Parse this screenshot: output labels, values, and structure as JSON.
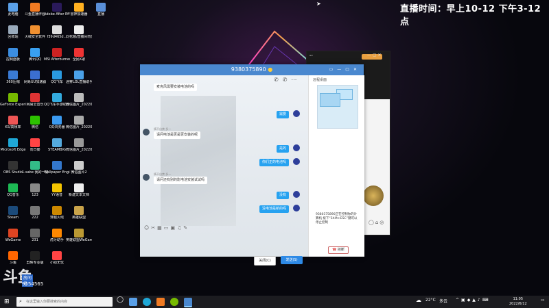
{
  "stream_time": "直播时间：早上10-12 下午3-12点",
  "desktop_icons": [
    {
      "label": "此电脑",
      "color": "#5aa0e8"
    },
    {
      "label": "斗鱼直播伴侣",
      "color": "#f07a22"
    },
    {
      "label": "Adobe After Effects 2021",
      "color": "#2a1a5a"
    },
    {
      "label": "雷神加速器",
      "color": "#ffb020"
    },
    {
      "label": "直播",
      "color": "#5a8fd8"
    },
    {
      "label": "回收站",
      "color": "#9ab"
    },
    {
      "label": "火绒安全软件",
      "color": "#f09030"
    },
    {
      "label": "f39d465d...",
      "color": "#ddd"
    },
    {
      "label": "同花顺/直播间背景",
      "color": "#eee"
    },
    {
      "label": "控制面板",
      "color": "#3b8de0"
    },
    {
      "label": "腾讯QQ",
      "color": "#39a0f0"
    },
    {
      "label": "MSI Afterburner",
      "color": "#c22"
    },
    {
      "label": "全民K歌",
      "color": "#e33"
    },
    {
      "label": "360压缩",
      "color": "#3a7bd5"
    },
    {
      "label": "网易UU加速器",
      "color": "#3b6fd0"
    },
    {
      "label": "QQ飞车",
      "color": "#2a9ae0"
    },
    {
      "label": "迷雾LOL直播助手",
      "color": "#4aa0e8"
    },
    {
      "label": "GeForce Experience",
      "color": "#76b900"
    },
    {
      "label": "网易云音乐",
      "color": "#d33"
    },
    {
      "label": "QQ飞车手游助手",
      "color": "#3ad"
    },
    {
      "label": "微信图片_2022051...",
      "color": "#bbb"
    },
    {
      "label": "KS/高帧率",
      "color": "#e55"
    },
    {
      "label": "微信",
      "color": "#2dc100"
    },
    {
      "label": "QQ浏览器",
      "color": "#3b9af0"
    },
    {
      "label": "微信图片_2022051...",
      "color": "#aaa"
    },
    {
      "label": "Microsoft Edge",
      "color": "#1fa7d6"
    },
    {
      "label": "向日葵",
      "color": "#f44"
    },
    {
      "label": "STEAMBIG",
      "color": "#5ad"
    },
    {
      "label": "微信图片_2022060...",
      "color": "#999"
    },
    {
      "label": "OBS Studio",
      "color": "#333"
    },
    {
      "label": "1-sabe 我的一键安装",
      "color": "#3b8"
    },
    {
      "label": "Wallpaper Engine",
      "color": "#37c"
    },
    {
      "label": "微信图片2",
      "color": "#ccc"
    },
    {
      "label": "QQ音乐",
      "color": "#1db954"
    },
    {
      "label": "123",
      "color": "#888"
    },
    {
      "label": "YY语音",
      "color": "#f4c400"
    },
    {
      "label": "新建文本文档",
      "color": "#eee"
    },
    {
      "label": "Steam",
      "color": "#1b4a7a"
    },
    {
      "label": "222",
      "color": "#777"
    },
    {
      "label": "穿越火线",
      "color": "#c80"
    },
    {
      "label": "英雄联盟",
      "color": "#c9a34a"
    },
    {
      "label": "WeGame",
      "color": "#d42"
    },
    {
      "label": "231",
      "color": "#666"
    },
    {
      "label": "虎牙助手",
      "color": "#f80"
    },
    {
      "label": "英雄联盟WeGame版",
      "color": "#b93"
    },
    {
      "label": "斗鱼",
      "color": "#f60"
    },
    {
      "label": "剪映专业版",
      "color": "#222"
    },
    {
      "label": "小助无忧",
      "color": "#f44"
    }
  ],
  "chat": {
    "title": "9380375890",
    "messages": [
      {
        "dir": "in",
        "text": "麦克风需要安装电池的吗",
        "sender": ""
      },
      {
        "dir": "out",
        "text": "需要",
        "sender": ""
      },
      {
        "dir": "in",
        "text": "请问电池是否是否安装的呢",
        "sender": "情不自禁·多一"
      },
      {
        "dir": "out",
        "text": "是的",
        "sender": ""
      },
      {
        "dir": "out",
        "text": "你们正的电池吗",
        "sender": ""
      },
      {
        "dir": "in",
        "text": "请问还有别的影电池安装试试吗",
        "sender": "情不自禁·多一"
      },
      {
        "dir": "out",
        "text": "没有",
        "sender": ""
      },
      {
        "dir": "out",
        "text": "没电池是新的吗",
        "sender": ""
      }
    ],
    "close_label": "关闭(C)",
    "send_label": "发送(S)",
    "side_title": "远程桌面",
    "side_note": "9380375890正在控制你的计算机 按下“Shift+ESC”键可以停止控制",
    "hangup_label": "挂断"
  },
  "watermark": {
    "logo": "斗鱼",
    "sub": "房间号",
    "room": "9554565"
  },
  "taskbar": {
    "search_placeholder": "在这里输入你要搜索的内容",
    "temperature": "22°C",
    "weather": "多云",
    "time": "11:05",
    "date": "2022/6/12"
  }
}
